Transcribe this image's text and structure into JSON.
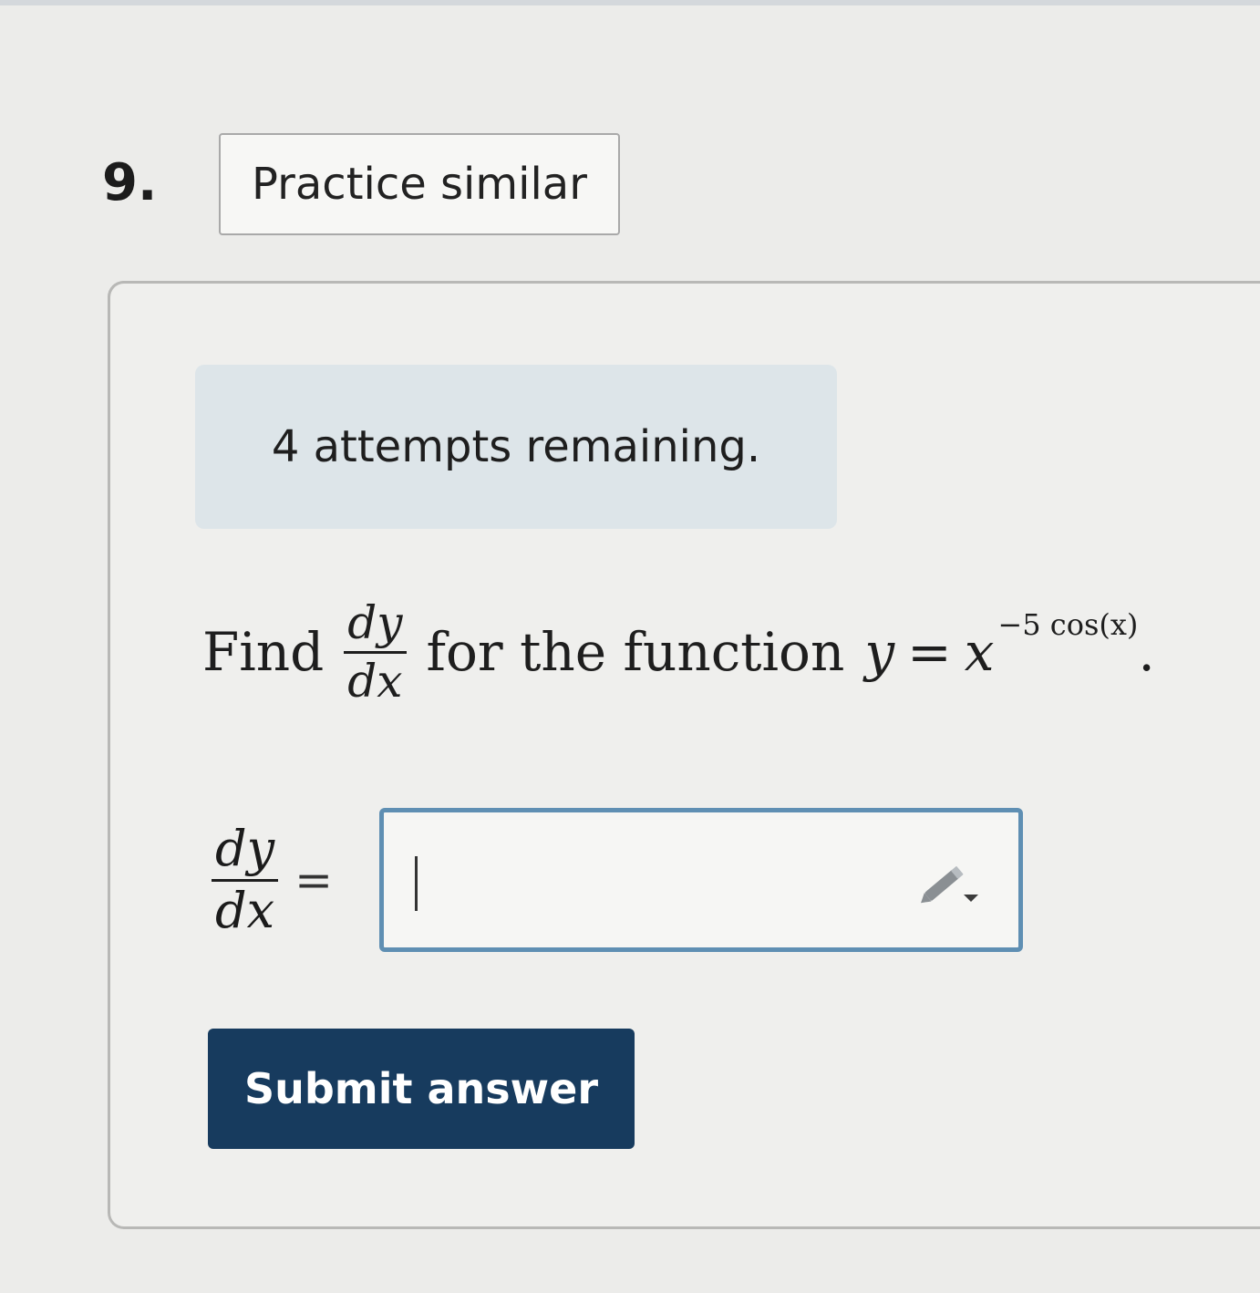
{
  "question": {
    "number": "9.",
    "practice_label": "Practice similar"
  },
  "status": {
    "attempts_text": "4 attempts remaining."
  },
  "problem": {
    "find_word": "Find",
    "deriv_num": "dy",
    "deriv_den": "dx",
    "mid_text": "for the function",
    "y_var": "y",
    "equals": "=",
    "base": "x",
    "exponent": "−5 cos(x)",
    "end": "."
  },
  "answer": {
    "lhs_num": "dy",
    "lhs_den": "dx",
    "equals": "=",
    "value": "",
    "icon": "pencil-dropdown-icon"
  },
  "actions": {
    "submit_label": "Submit answer"
  },
  "colors": {
    "submit_bg": "#173b5e",
    "input_border": "#5f8fb3",
    "attempts_bg": "#dde5e9"
  }
}
